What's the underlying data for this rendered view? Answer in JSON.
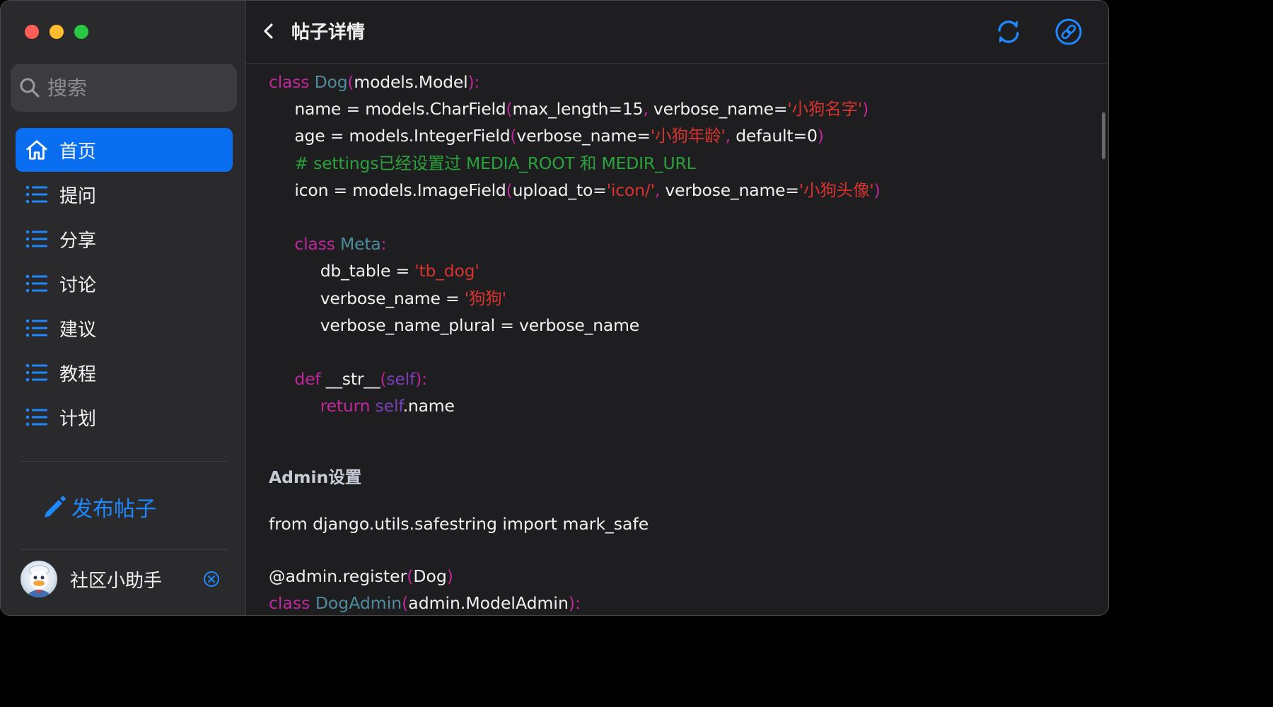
{
  "window": {
    "traffic_colors": [
      "#ff5f57",
      "#febc2e",
      "#28c840"
    ]
  },
  "sidebar": {
    "search_placeholder": "搜索",
    "items": [
      {
        "label": "首页",
        "icon": "home-icon",
        "active": true
      },
      {
        "label": "提问",
        "icon": "list-icon"
      },
      {
        "label": "分享",
        "icon": "list-icon"
      },
      {
        "label": "讨论",
        "icon": "list-icon"
      },
      {
        "label": "建议",
        "icon": "list-icon"
      },
      {
        "label": "教程",
        "icon": "list-icon"
      },
      {
        "label": "计划",
        "icon": "list-icon"
      }
    ],
    "publish_label": "发布帖子",
    "user_name": "社区小助手"
  },
  "header": {
    "title": "帖子详情"
  },
  "post": {
    "code_lines": [
      "class Dog(models.Model):",
      "    name = models.CharField(max_length=15, verbose_name='小狗名字')",
      "    age = models.IntegerField(verbose_name='小狗年龄', default=0)",
      "    # settings已经设置过 MEDIA_ROOT 和 MEDIR_URL",
      "    icon = models.ImageField(upload_to='icon/', verbose_name='小狗头像')",
      "",
      "    class Meta:",
      "        db_table = 'tb_dog'",
      "        verbose_name = '狗狗'",
      "        verbose_name_plural = verbose_name",
      "",
      "    def __str__(self):",
      "        return self.name"
    ],
    "section_heading": "Admin设置",
    "import_line": "from django.utils.safestring import mark_safe",
    "decorator_line": "@admin.register(Dog)",
    "class_line": "class DogAdmin(admin.ModelAdmin):"
  },
  "colors": {
    "accent": "#0a6ef0",
    "link": "#1e88ff",
    "keyword": "#c0279d",
    "string": "#d8342f",
    "comment": "#2aa33b"
  }
}
